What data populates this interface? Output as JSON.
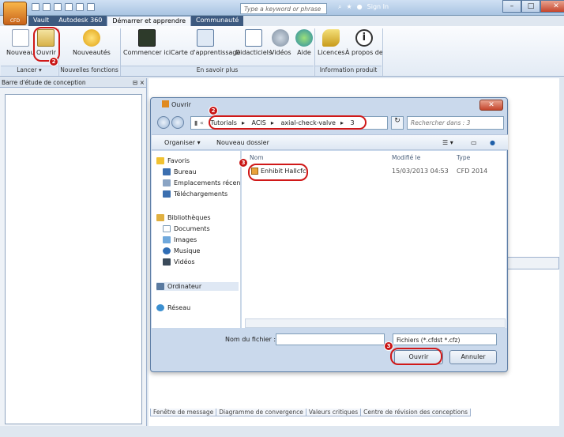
{
  "app": {
    "logo_label": "CFD",
    "search_placeholder": "Type a keyword or phrase",
    "sign_in": "Sign In",
    "menu_tabs": [
      "Vault",
      "Autodesk 360",
      "Démarrer et apprendre",
      "Communauté"
    ]
  },
  "ribbon": {
    "buttons": [
      "Nouveau",
      "Ouvrir",
      "Nouveautés",
      "Commencer ici",
      "Carte d'apprentissage",
      "Didacticiels",
      "Vidéos",
      "Aide",
      "Licences",
      "À propos de"
    ],
    "groups": [
      "Lancer ▾",
      "Nouvelles fonctions",
      "En savoir plus",
      "Information produit"
    ]
  },
  "left_panel": {
    "title": "Barre d'étude de conception",
    "pin": "⊟ ×"
  },
  "bottom_tabs": [
    "Fenêtre de message",
    "Diagramme de convergence",
    "Valeurs critiques",
    "Centre de révision des conceptions"
  ],
  "dialog": {
    "title": "Ouvrir",
    "breadcrumb": [
      "Tutorials",
      "ACIS",
      "axial-check-valve",
      "3"
    ],
    "search_placeholder": "Rechercher dans : 3",
    "toolbar": {
      "organize": "Organiser ▾",
      "new_folder": "Nouveau dossier"
    },
    "nav": {
      "favorites": "Favoris",
      "desktop": "Bureau",
      "recent": "Emplacements récen",
      "downloads": "Téléchargements",
      "libraries": "Bibliothèques",
      "documents": "Documents",
      "images": "Images",
      "music": "Musique",
      "videos": "Vidéos",
      "computer": "Ordinateur",
      "network": "Réseau"
    },
    "columns": {
      "name": "Nom",
      "modified": "Modifié le",
      "type": "Type"
    },
    "files": [
      {
        "name": "Enhibit Hallcfc",
        "modified": "15/03/2013 04:53",
        "type": "CFD 2014"
      }
    ],
    "filename_label": "Nom du fichier :",
    "filename_value": "",
    "filetype": "Fichiers (*.cfdst *.cfz)",
    "open_btn": "Ouvrir",
    "cancel_btn": "Annuler"
  },
  "badges": {
    "b1": "2",
    "b2": "2",
    "b3": "3",
    "b4": "3"
  },
  "colors": {
    "annotation": "#d01818",
    "title_bar": "#a9c4e2"
  }
}
